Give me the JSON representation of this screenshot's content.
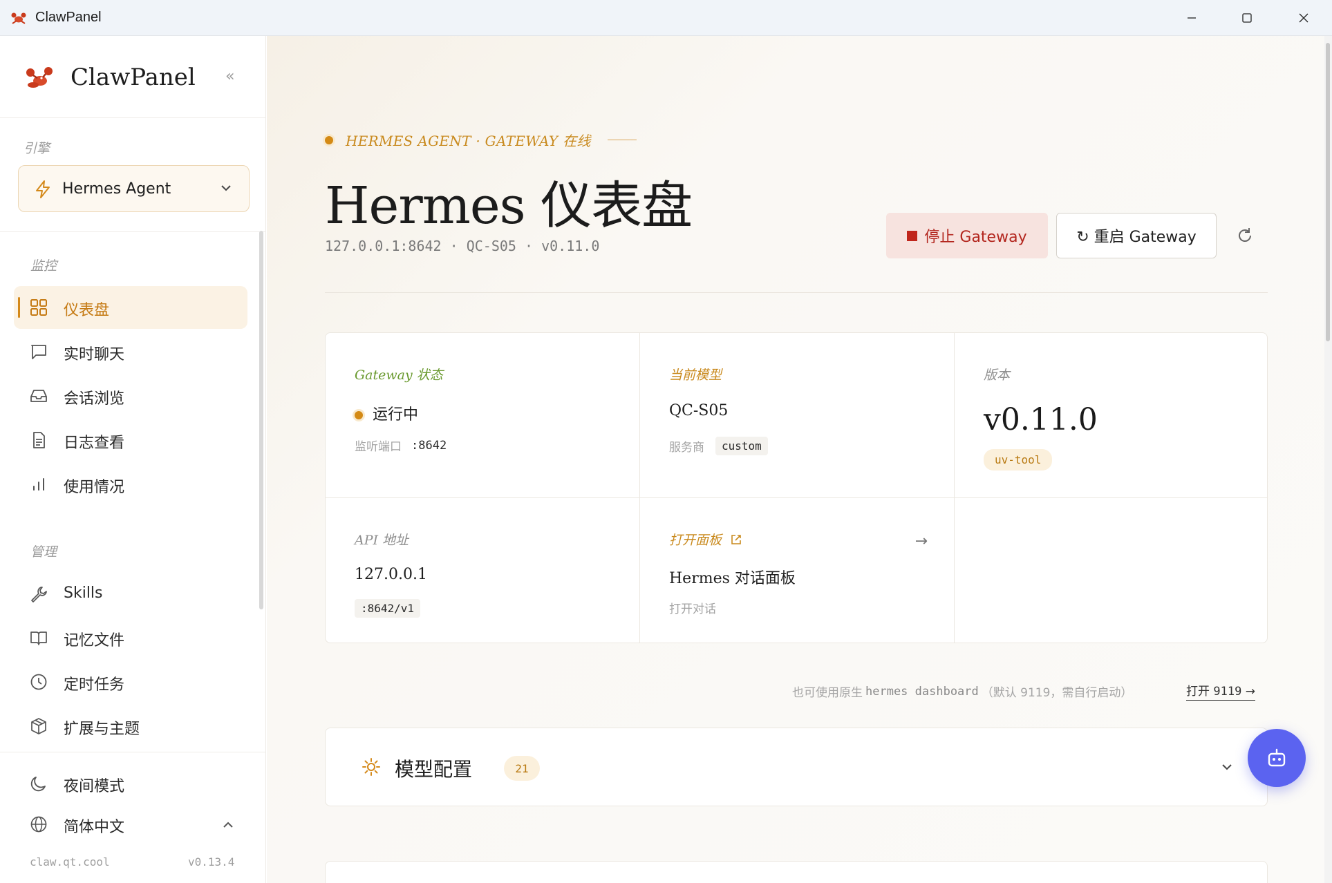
{
  "window": {
    "title": "ClawPanel"
  },
  "sidebar": {
    "brand": "ClawPanel",
    "collapse_glyph": "«",
    "engine_label": "引擎",
    "engine_value": "Hermes Agent",
    "monitor_label": "监控",
    "monitor_items": [
      {
        "label": "仪表盘",
        "icon": "grid-icon",
        "active": true
      },
      {
        "label": "实时聊天",
        "icon": "chat-icon"
      },
      {
        "label": "会话浏览",
        "icon": "inbox-icon"
      },
      {
        "label": "日志查看",
        "icon": "document-icon"
      },
      {
        "label": "使用情况",
        "icon": "bar-chart-icon"
      }
    ],
    "manage_label": "管理",
    "manage_items": [
      {
        "label": "Skills",
        "icon": "wrench-icon"
      },
      {
        "label": "记忆文件",
        "icon": "book-icon"
      },
      {
        "label": "定时任务",
        "icon": "clock-icon"
      },
      {
        "label": "扩展与主题",
        "icon": "package-icon"
      }
    ],
    "night_mode": "夜间模式",
    "language": "简体中文",
    "site": "claw.qt.cool",
    "version": "v0.13.4"
  },
  "header": {
    "status": "HERMES AGENT · GATEWAY 在线",
    "title": "Hermes 仪表盘",
    "subtitle": "127.0.0.1:8642 · QC-S05 · v0.11.0",
    "stop_button": "停止 Gateway",
    "restart_button": "↻ 重启 Gateway"
  },
  "cards": {
    "gateway": {
      "label": "Gateway 状态",
      "value": "运行中",
      "sub_label": "监听端口",
      "sub_value": ":8642"
    },
    "model": {
      "label": "当前模型",
      "value": "QC-S05",
      "sub_label": "服务商",
      "sub_value": "custom"
    },
    "version": {
      "label": "版本",
      "value": "v0.11.0",
      "badge": "uv-tool"
    },
    "api": {
      "label": "API 地址",
      "value": "127.0.0.1",
      "chip": ":8642/v1"
    },
    "panel": {
      "label": "打开面板",
      "value": "Hermes 对话面板",
      "sub": "打开对话",
      "arrow": "→"
    }
  },
  "hint": {
    "prefix": "也可使用原生",
    "command": "hermes dashboard",
    "suffix": "（默认 9119，需自行启动）",
    "link_prefix": "打开",
    "link_port": "9119",
    "link_arrow": "→"
  },
  "model_section": {
    "title": "模型配置",
    "count": "21"
  },
  "colors": {
    "accent": "#d4891a",
    "stop_red": "#b3261e",
    "fab": "#5b63f0",
    "green_label": "#6a9a2f"
  }
}
